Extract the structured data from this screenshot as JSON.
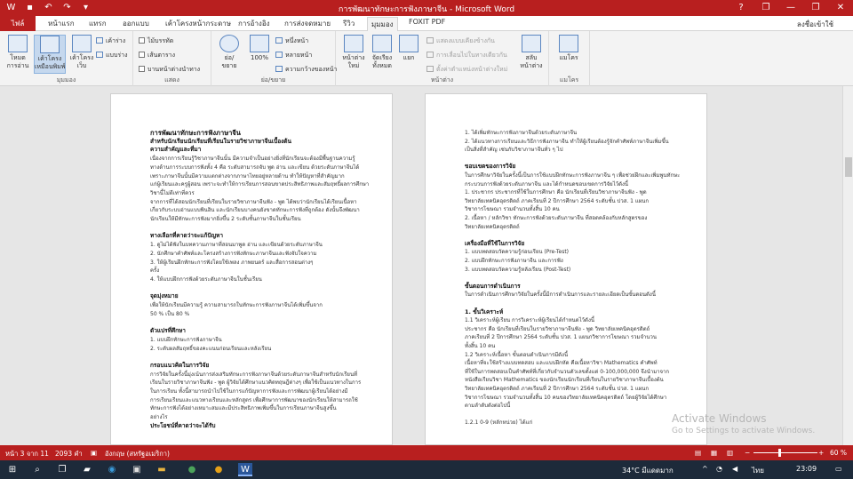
{
  "window": {
    "title": "การพัฒนาทักษะการฟังภาษาจีน  -  Microsoft Word",
    "sign_in": "ลงชื่อเข้าใช้",
    "controls": [
      "?",
      "❐",
      "—",
      "❐",
      "✕"
    ]
  },
  "qat": {
    "icons": [
      "word-logo",
      "save",
      "undo",
      "redo",
      "more"
    ]
  },
  "tabs": [
    "ไฟล์",
    "หน้าแรก",
    "แทรก",
    "ออกแบบ",
    "เค้าโครงหน้ากระดาษ",
    "การอ้างอิง",
    "การส่งจดหมาย",
    "รีวิว",
    "มุมมอง",
    "FOXIT PDF"
  ],
  "active_tab": "มุมมอง",
  "ribbon": {
    "views": {
      "label": "มุมมอง",
      "read": "โหมด\nการอ่าน",
      "print": "เค้าโครง\nเหมือนพิมพ์",
      "web": "เค้าโครง\nเว็บ",
      "outline": "เค้าร่าง",
      "draft": "แบบร่าง"
    },
    "show": {
      "label": "แสดง",
      "ruler": "ไม้บรรทัด",
      "grid": "เส้นตาราง",
      "nav": "บานหน้าต่างนำทาง"
    },
    "zoom": {
      "label": "ย่อ/ขยาย",
      "zoom": "ย่อ/\nขยาย",
      "hundred": "100%",
      "one_page": "หนึ่งหน้า",
      "multi": "หลายหน้า",
      "width": "ความกว้างของหน้า"
    },
    "window": {
      "label": "หน้าต่าง",
      "new": "หน้าต่าง\nใหม่",
      "arrange": "จัดเรียง\nทั้งหมด",
      "split": "แยก",
      "side": "แสดงแบบเคียงข้างกัน",
      "sync": "การเลื่อนไปในทางเดียวกัน",
      "reset": "ตั้งค่าตำแหน่งหน้าต่างใหม่",
      "switch": "สลับ\nหน้าต่าง"
    },
    "macros": {
      "label": "แมโคร",
      "btn": "แมโคร"
    }
  },
  "page1": [
    {
      "t": "การพัฒนาทักษะการฟังภาษาจีน",
      "c": "h1"
    },
    {
      "t": "สำหรับนักเรียนนักเรียนที่เรียนในรายวิชาภาษาจีนเบื้องต้น",
      "c": "h"
    },
    {
      "t": "ความสำคัญและที่มา",
      "c": "h"
    },
    {
      "t": "          เนื่องจากการเรียนรู้วิชาภาษาจีนนั้น มีความจำเป็นอย่างยิ่งที่นักเรียนจะต้องมีพื้นฐานความรู้"
    },
    {
      "t": "ทางด้านการระบบการฟังทั้ง 4 คือ ระดับสามารถจับ พูด อ่าน และเขียน ด้วยระดับภาษาจีนได้"
    },
    {
      "t": "เพราะภาษาจีนนั้นมีความแตกต่างจากภาษาไทยอยู่หลายด้าน ทำให้ปัญหาที่สำคัญมาก"
    },
    {
      "t": "แก่ผู้เรียนและครูผู้สอน เพราะจะทำให้การเรียนการสอนขาดประสิทธิภาพและสัมฤทธิ์ผลการศึกษา"
    },
    {
      "t": "วิชานี้ไม่ดีเท่าที่ควร"
    },
    {
      "t": "          จากการที่ได้สอนนักเรียนที่เรียนในรายวิชาภาษาจีนฟัง - พูด ได้พบว่านักเรียนได้เรียนเนื้อหา"
    },
    {
      "t": "เกี่ยวกับระบบอ่านแบบพินอิน และนักเรียนบางคนยังขาดทักษะการฟังที่ถูกต้อง ดังนั้นจึงพัฒนา"
    },
    {
      "t": "นักเรียนให้มีทักษะการฟังมากยิ่งขึ้น 2 ระดับชั้นภาษาจีนในชั้นเรียน"
    },
    {
      "t": ""
    },
    {
      "t": "ทางเลือกที่คาดว่าจะแก้ปัญหา",
      "c": "h"
    },
    {
      "t": "          1.   ดูไม่ได้ฟังในบทความภาษาที่สอนมาพูด อ่าน และเขียนด้วยระดับภาษาจีน"
    },
    {
      "t": "          2.   นักศึกษาคำศัพท์และโครงสร้างการฟังทักษะภาษาจีนและฟังจับใจความ"
    },
    {
      "t": "          3.   ให้ผู้เรียนฝึกทักษะการฟังโดยใช้เพลง ภาพยนตร์ และสื่อการสอนต่างๆ"
    },
    {
      "t": "               ครั้ง"
    },
    {
      "t": "          4.   ให้แบบฝึกการฟังด้วยระดับภาษาจีนในชั้นเรียน"
    },
    {
      "t": ""
    },
    {
      "t": "จุดมุ่งหมาย",
      "c": "h"
    },
    {
      "t": "          เพื่อให้นักเรียนมีความรู้ ความสามารถในทักษะการฟังภาษาจีนได้เพิ่มขึ้นจาก"
    },
    {
      "t": "50 % เป็น 80 %"
    },
    {
      "t": ""
    },
    {
      "t": "ตัวแปรที่ศึกษา",
      "c": "h"
    },
    {
      "t": "          1.   แบบฝึกทักษะการฟังภาษาจีน"
    },
    {
      "t": "          2.   ระดับผลสัมฤทธิ์ของคะแนนก่อนเรียนและหลังเรียน"
    },
    {
      "t": ""
    },
    {
      "t": "กรอบแนวคิดในการวิจัย",
      "c": "h"
    },
    {
      "t": "          การวิจัยในครั้งนี้มุ่งเน้นการส่งเสริมทักษะการฟังภาษาจีนด้วยระดับภาษาจีนสำหรับนักเรียนที่"
    },
    {
      "t": "เรียนในรายวิชาภาษาจีนฟัง - พูด ผู้วิจัยได้ศึกษาแนวคิดทฤษฎีต่างๆ เพื่อใช้เป็นแนวทางในการ"
    },
    {
      "t": "ในการเรียน ทั้งนี้สามารถนำไปใช้ในการแก้ปัญหาการฟังและการพัฒนาผู้เรียนได้อย่างมี"
    },
    {
      "t": "การเรียนเรียนและแนวทางเรียนและหลักสูตร เพื่อศึกษาการพัฒนาของนักเรียนให้สามารถใช้"
    },
    {
      "t": "ทักษะการฟังได้อย่างเหมาะสมและมีประสิทธิภาพเพิ่มขึ้นในการเรียนภาษาจีนสูงขึ้น"
    },
    {
      "t": "อย่างไร"
    },
    {
      "t": "ประโยชน์ที่คาดว่าจะได้รับ",
      "c": "h"
    }
  ],
  "page2": [
    {
      "t": "     1.   ได้เพิ่มทักษะการฟังภาษาจีนด้วยระดับภาษาจีน"
    },
    {
      "t": "     2.   ได้แนวทางการเรียนและวิธีการฟังภาษาจีน ทำให้ผู้เรียนต้องรู้จักคำศัพท์ภาษาจีนเพิ่มขึ้น"
    },
    {
      "t": "          เป็นสิ่งที่สำคัญ เช่นกับวิชาภาษาจีนทั่ว ๆ ไป"
    },
    {
      "t": ""
    },
    {
      "t": "ขอบเขตของการวิจัย",
      "c": "h"
    },
    {
      "t": "     ในการศึกษาวิจัยในครั้งนี้เป็นการใช้แบบฝึกทักษะการฟังภาษาจีน ๆ เพื่อช่วยฝึกและเพิ่มพูนทักษะ"
    },
    {
      "t": "กระบวนการฟังด้วยระดับภาษาจีน และได้กำหนดขอบเขตการวิจัยไว้ดังนี้"
    },
    {
      "t": "     1.   ประชากร ประชากรที่ใช้ในการศึกษา คือ นักเรียนที่เรียนวิชาภาษาจีนฟัง - พูด"
    },
    {
      "t": "          วิทยาลัยเทคนิคอุตรดิตถ์ ภาคเรียนที่ 2 ปีการศึกษา 2564 ระดับชั้น ปวส. 1 แผนก"
    },
    {
      "t": "          วิชาการโฆษณา รวมจำนวนทั้งสิ้น 10 คน"
    },
    {
      "t": "     2.   เนื้อหา / หลักวิชา ทักษะการฟังด้วยระดับภาษาจีน ที่สอดคล้องกับหลักสูตรของ"
    },
    {
      "t": "          วิทยาลัยเทคนิคอุตรดิตถ์"
    },
    {
      "t": ""
    },
    {
      "t": "เครื่องมือที่ใช้ในการวิจัย",
      "c": "h"
    },
    {
      "t": "     1.   แบบทดสอบวัดความรู้ก่อนเรียน (Pre-Test)"
    },
    {
      "t": "     2.   แบบฝึกทักษะการฟังภาษาจีน และการฟัง"
    },
    {
      "t": "     3.   แบบทดสอบวัดความรู้หลังเรียน (Post-Test)"
    },
    {
      "t": ""
    },
    {
      "t": "ขั้นตอนการดำเนินการ",
      "c": "h"
    },
    {
      "t": "     ในการดำเนินการศึกษาวิจัยในครั้งนี้มีการดำเนินการและรายละเอียดเป็นขั้นตอนดังนี้"
    },
    {
      "t": ""
    },
    {
      "t": "     1.   ขั้นวิเคราะห์",
      "c": "h"
    },
    {
      "t": "          1.1 วิเคราะห์ผู้เรียน การวิเคราะห์ผู้เรียนได้กำหนดไว้ดังนี้"
    },
    {
      "t": "               ประชากร คือ นักเรียนที่เรียนในรายวิชาภาษาจีนฟัง - พูด วิทยาลัยเทคนิคอุตรดิตถ์"
    },
    {
      "t": "          ภาคเรียนที่ 2 ปีการศึกษา 2564 ระดับชั้น ปวส. 1 แผนกวิชาการโฆษณา รวมจำนวน"
    },
    {
      "t": "          ทั้งสิ้น 10 คน"
    },
    {
      "t": "          1.2 วิเคราะห์เนื้อหา ขั้นตอนดำเนินการมีดังนี้"
    },
    {
      "t": "               เนื้อหาที่จะใช้สร้างแบบทดสอบ และแบบฝึกหัด คือเนื้อหาวิชา Mathematics คำศัพท์"
    },
    {
      "t": "          ที่ใช้ในการทดสอบเป็นคำศัพท์ที่เกี่ยวกับจำนวนตัวเลขตั้งแต่ 0-100,000,000 จึงนำมาจาก"
    },
    {
      "t": "          หนังสือเรียนวิชา Mathematics ของนักเรียนนักเรียนที่เรียนในรายวิชาภาษาจีนเบื้องต้น"
    },
    {
      "t": "          วิทยาลัยเทคนิคอุตรดิตถ์ ภาคเรียนที่ 2 ปีการศึกษา 2564 ระดับชั้น ปวส. 1 แผนก"
    },
    {
      "t": "          วิชาการโฆษณา รวมจำนวนทั้งสิ้น 10 คนของวิทยาลัยเทคนิคอุตรดิตถ์ โดยผู้วิจัยได้ศึกษา"
    },
    {
      "t": "          ตามลำดับดังต่อไปนี้"
    },
    {
      "t": ""
    },
    {
      "t": "               1.2.1   0-9 (หลักหน่วย) ได้แก่"
    }
  ],
  "watermark": {
    "line1": "Activate Windows",
    "line2": "Go to Settings to activate Windows."
  },
  "status": {
    "page": "หน้า 3 จาก 11",
    "words": "2093 คำ",
    "lang": "อังกฤษ (สหรัฐอเมริกา)",
    "zoom": "60 %"
  },
  "taskbar": {
    "weather": "34°C  มีแดดมาก",
    "lang": "ไทย",
    "time": "23:09",
    "icons": [
      "windows",
      "search",
      "task-view",
      "file-explorer",
      "edge",
      "chrome",
      "mail",
      "word"
    ]
  }
}
